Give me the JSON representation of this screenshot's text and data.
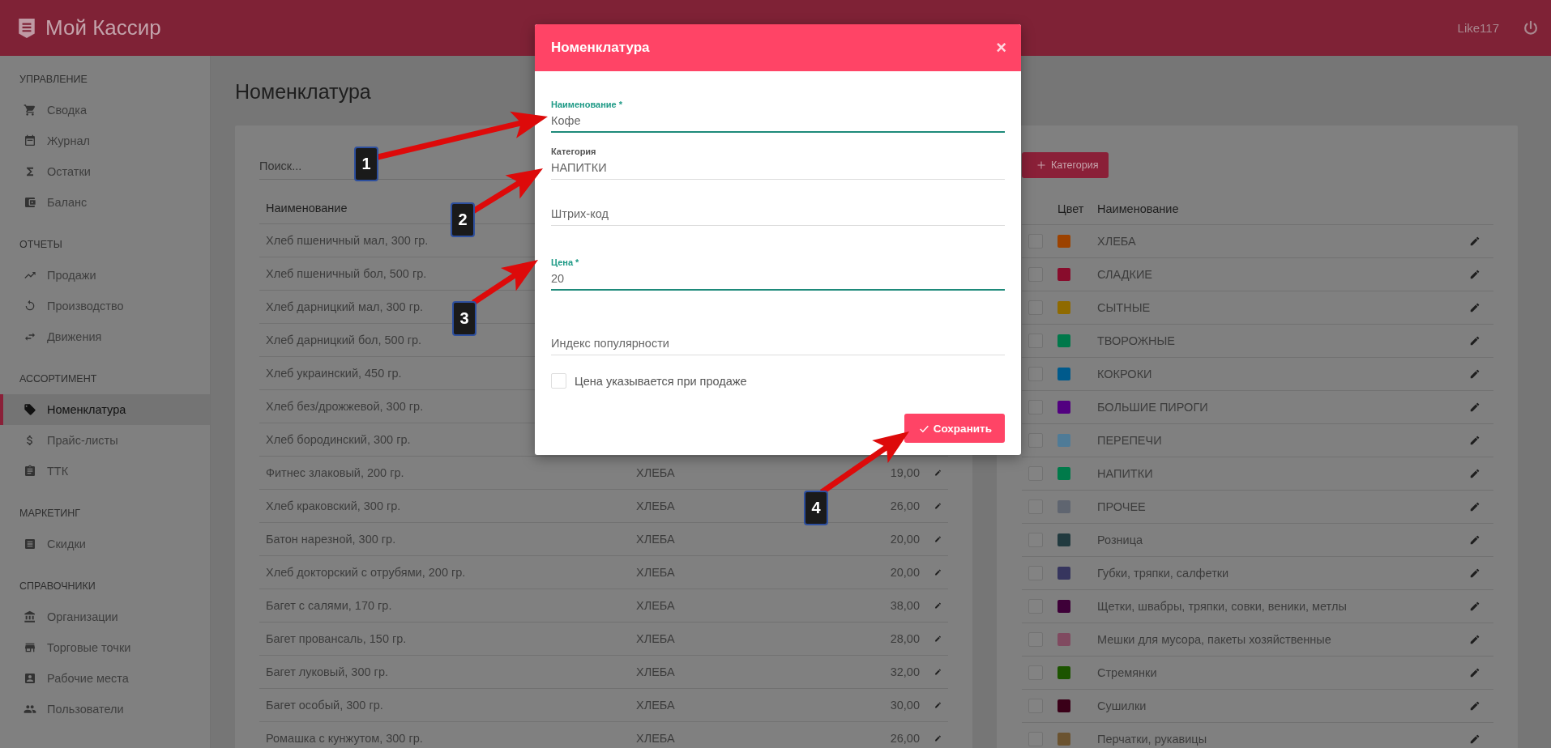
{
  "app": {
    "logo": "Мой Кассир",
    "user": "Like117"
  },
  "sidebar": {
    "sections": [
      {
        "title": "УПРАВЛЕНИЕ",
        "items": [
          {
            "label": "Сводка",
            "selected": false
          },
          {
            "label": "Журнал",
            "selected": false
          },
          {
            "label": "Остатки",
            "selected": false
          },
          {
            "label": "Баланс",
            "selected": false
          }
        ]
      },
      {
        "title": "ОТЧЕТЫ",
        "items": [
          {
            "label": "Продажи",
            "selected": false
          },
          {
            "label": "Производство",
            "selected": false
          },
          {
            "label": "Движения",
            "selected": false
          }
        ]
      },
      {
        "title": "АССОРТИМЕНТ",
        "items": [
          {
            "label": "Номенклатура",
            "selected": true
          },
          {
            "label": "Прайс-листы",
            "selected": false
          },
          {
            "label": "ТТК",
            "selected": false
          }
        ]
      },
      {
        "title": "МАРКЕТИНГ",
        "items": [
          {
            "label": "Скидки",
            "selected": false
          }
        ]
      },
      {
        "title": "СПРАВОЧНИКИ",
        "items": [
          {
            "label": "Организации",
            "selected": false
          },
          {
            "label": "Торговые точки",
            "selected": false
          },
          {
            "label": "Рабочие места",
            "selected": false
          },
          {
            "label": "Пользователи",
            "selected": false
          }
        ]
      }
    ]
  },
  "page": {
    "title": "Номенклатура"
  },
  "products": {
    "search": {
      "placeholder": "Поиск..."
    },
    "columns": [
      "Наименование"
    ],
    "rows": [
      {
        "name": "Хлеб пшеничный мал, 300 гр."
      },
      {
        "name": "Хлеб пшеничный бол, 500 гр."
      },
      {
        "name": "Хлеб дарницкий мал, 300 гр."
      },
      {
        "name": "Хлеб дарницкий бол, 500 гр."
      },
      {
        "name": "Хлеб украинский, 450 гр."
      },
      {
        "name": "Хлеб без/дрожжевой, 300 гр."
      },
      {
        "name": "Хлеб бородинский, 300 гр."
      },
      {
        "name": "Фитнес злаковый, 200 гр.",
        "category": "ХЛЕБА",
        "price": "19,00"
      },
      {
        "name": "Хлеб краковский, 300 гр.",
        "category": "ХЛЕБА",
        "price": "26,00"
      },
      {
        "name": "Батон нарезной, 300 гр.",
        "category": "ХЛЕБА",
        "price": "20,00"
      },
      {
        "name": "Хлеб докторский с отрубями, 200 гр.",
        "category": "ХЛЕБА",
        "price": "20,00"
      },
      {
        "name": "Багет с салями, 170 гр.",
        "category": "ХЛЕБА",
        "price": "38,00"
      },
      {
        "name": "Багет провансаль, 150 гр.",
        "category": "ХЛЕБА",
        "price": "28,00"
      },
      {
        "name": "Багет луковый, 300 гр.",
        "category": "ХЛЕБА",
        "price": "32,00"
      },
      {
        "name": "Багет особый, 300 гр.",
        "category": "ХЛЕБА",
        "price": "30,00"
      },
      {
        "name": "Ромашка с кунжутом, 300 гр.",
        "category": "ХЛЕБА",
        "price": "26,00"
      }
    ]
  },
  "categories": {
    "add_button": "Категория",
    "columns": [
      "Цвет",
      "Наименование"
    ],
    "rows": [
      {
        "name": "ХЛЕБА",
        "color": "#9c4200",
        "checked": false
      },
      {
        "name": "СЛАДКИЕ",
        "color": "#880c2c",
        "checked": false
      },
      {
        "name": "СЫТНЫЕ",
        "color": "#8f6a00",
        "checked": false
      },
      {
        "name": "ТВОРОЖНЫЕ",
        "color": "#00784a",
        "checked": false
      },
      {
        "name": "КОКРОКИ",
        "color": "#005a8c",
        "checked": false
      },
      {
        "name": "БОЛЬШИЕ ПИРОГИ",
        "color": "#520080",
        "checked": false
      },
      {
        "name": "ПЕРЕПЕЧИ",
        "color": "#4f7b97",
        "checked": false
      },
      {
        "name": "НАПИТКИ",
        "color": "#007a4a",
        "checked": false
      },
      {
        "name": "ПРОЧЕЕ",
        "color": "#5f6570",
        "checked": false
      },
      {
        "name": "Розница",
        "color": "#213a3f",
        "checked": false
      },
      {
        "name": "Губки, тряпки, салфетки",
        "color": "#36355e",
        "checked": false
      },
      {
        "name": "Щетки, швабры, тряпки, совки, веники, метлы",
        "color": "#3e0038",
        "checked": false
      },
      {
        "name": "Мешки для мусора, пакеты хозяйственные",
        "color": "#804a60",
        "checked": false
      },
      {
        "name": "Стремянки",
        "color": "#1c5400",
        "checked": false
      },
      {
        "name": "Сушилки",
        "color": "#3a0018",
        "checked": false
      },
      {
        "name": "Перчатки, рукавицы",
        "color": "#6b5330",
        "checked": false
      }
    ]
  },
  "dialog": {
    "title": "Номенклатура",
    "close": "×",
    "fields": [
      {
        "label": "Наименование *",
        "value": "Кофе",
        "highlighted": true
      },
      {
        "label": "Категория",
        "value": "НАПИТКИ",
        "highlighted": false
      },
      {
        "placeholder": "Штрих-код",
        "highlighted": false
      },
      {
        "label": "Цена *",
        "value": "20",
        "highlighted": true
      },
      {
        "placeholder": "Индекс популярности",
        "highlighted": false
      }
    ],
    "checkbox": {
      "label": "Цена указывается при продаже",
      "checked": false
    },
    "save_button": "Сохранить"
  },
  "annotations": [
    {
      "number": "1"
    },
    {
      "number": "2"
    },
    {
      "number": "3"
    },
    {
      "number": "4"
    }
  ]
}
